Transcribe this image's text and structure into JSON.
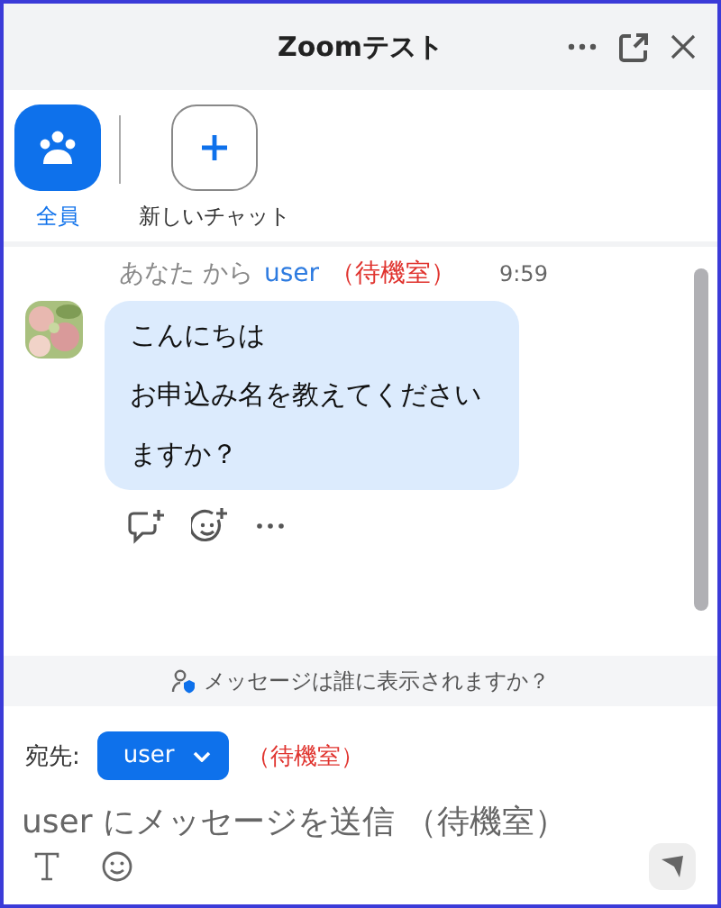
{
  "window": {
    "title": "Zoomテスト"
  },
  "chats": [
    {
      "label": "全員",
      "kind": "everyone",
      "selected": true
    },
    {
      "label": "新しいチャット",
      "kind": "new",
      "selected": false
    }
  ],
  "message": {
    "from_label": "あなた から",
    "to": "user",
    "to_status": "（待機室）",
    "time": "9:59",
    "lines": [
      "こんにちは",
      "お申込み名を教えてください",
      "ますか？"
    ]
  },
  "notice": "メッセージは誰に表示されますか？",
  "recipient": {
    "label": "宛先:",
    "value": "user",
    "status": "（待機室）"
  },
  "input": {
    "placeholder": "user にメッセージを送信 （待機室）"
  }
}
